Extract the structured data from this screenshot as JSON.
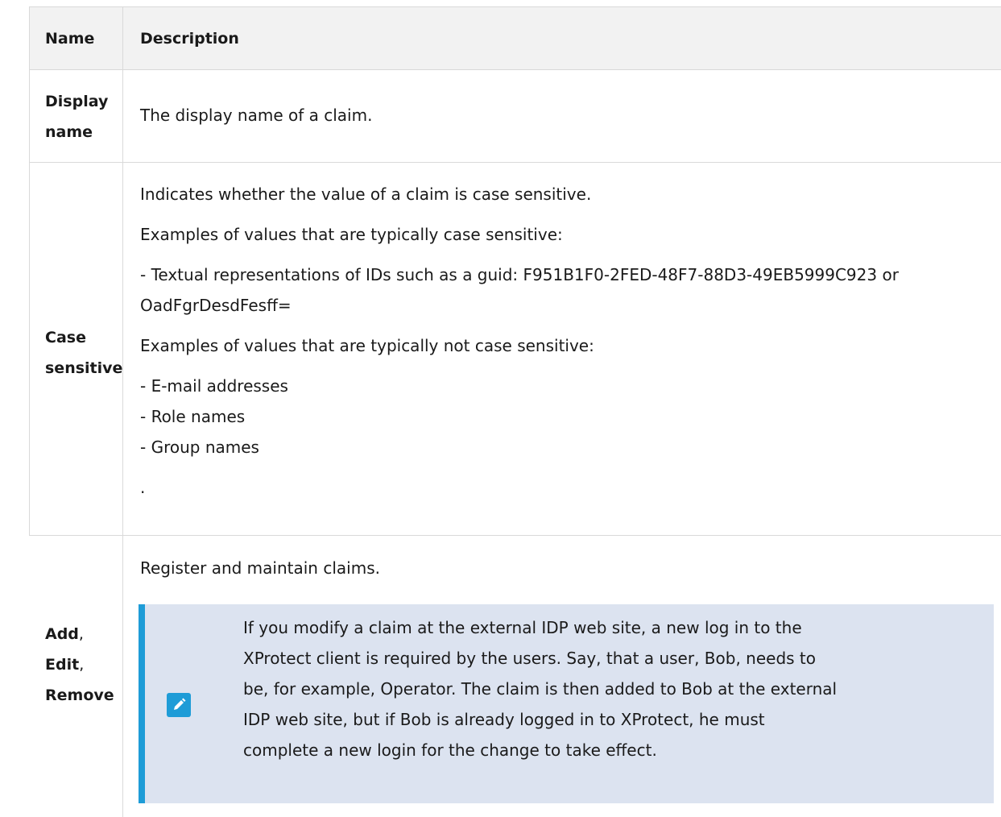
{
  "table": {
    "headers": {
      "name": "Name",
      "description": "Description"
    },
    "rows": [
      {
        "name_lines": [
          "Display",
          "name"
        ],
        "description": [
          "The display name of a claim."
        ]
      },
      {
        "name_lines": [
          "Case",
          "sensitive"
        ],
        "description": [
          "Indicates whether the value of a claim is case sensitive.",
          "Examples of values that are typically case sensitive:",
          "- Textual representations of IDs such as a guid: F951B1F0-2FED-48F7-88D3-49EB5999C923 or",
          "OadFgrDesdFesff=",
          "Examples of values that are typically not case sensitive:",
          "- E-mail addresses",
          "- Role names",
          "- Group names",
          "."
        ]
      },
      {
        "name_lines": [
          "Add",
          ",",
          "Edit",
          ",",
          "Remove"
        ],
        "description": [
          "Register and maintain claims."
        ],
        "note": {
          "icon": "pencil-icon",
          "lines": [
            "If you modify a claim at the external IDP web site, a new log in to the",
            "XProtect client is required by the users. Say, that a user, Bob, needs to",
            "be, for example, Operator. The claim is then added to Bob at the external",
            "IDP web site, but if Bob is already logged in to XProtect, he must",
            "complete a new login for the change to take effect."
          ]
        }
      }
    ]
  },
  "colors": {
    "note_background": "#dce3f0",
    "note_accent": "#1e9cd7",
    "grid": "#d9d9d9",
    "header_background": "#f2f2f2"
  }
}
